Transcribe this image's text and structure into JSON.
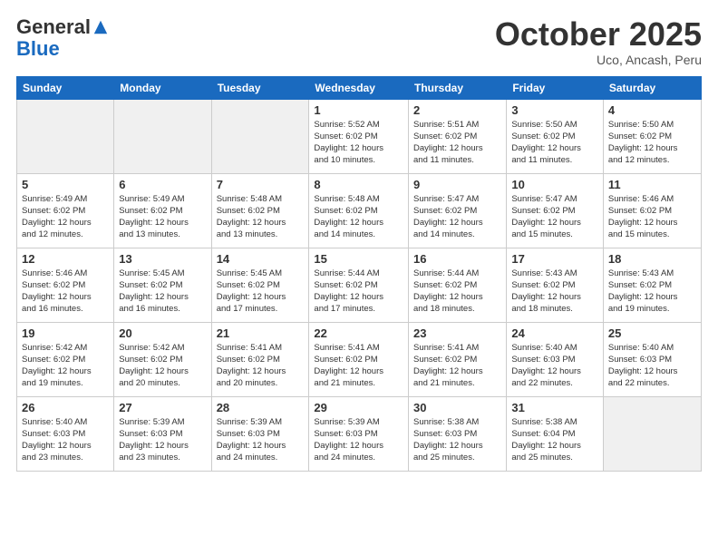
{
  "header": {
    "logo_general": "General",
    "logo_blue": "Blue",
    "month_title": "October 2025",
    "location": "Uco, Ancash, Peru"
  },
  "weekdays": [
    "Sunday",
    "Monday",
    "Tuesday",
    "Wednesday",
    "Thursday",
    "Friday",
    "Saturday"
  ],
  "weeks": [
    [
      {
        "day": "",
        "info": "",
        "empty": true
      },
      {
        "day": "",
        "info": "",
        "empty": true
      },
      {
        "day": "",
        "info": "",
        "empty": true
      },
      {
        "day": "1",
        "info": "Sunrise: 5:52 AM\nSunset: 6:02 PM\nDaylight: 12 hours\nand 10 minutes.",
        "empty": false
      },
      {
        "day": "2",
        "info": "Sunrise: 5:51 AM\nSunset: 6:02 PM\nDaylight: 12 hours\nand 11 minutes.",
        "empty": false
      },
      {
        "day": "3",
        "info": "Sunrise: 5:50 AM\nSunset: 6:02 PM\nDaylight: 12 hours\nand 11 minutes.",
        "empty": false
      },
      {
        "day": "4",
        "info": "Sunrise: 5:50 AM\nSunset: 6:02 PM\nDaylight: 12 hours\nand 12 minutes.",
        "empty": false
      }
    ],
    [
      {
        "day": "5",
        "info": "Sunrise: 5:49 AM\nSunset: 6:02 PM\nDaylight: 12 hours\nand 12 minutes.",
        "empty": false
      },
      {
        "day": "6",
        "info": "Sunrise: 5:49 AM\nSunset: 6:02 PM\nDaylight: 12 hours\nand 13 minutes.",
        "empty": false
      },
      {
        "day": "7",
        "info": "Sunrise: 5:48 AM\nSunset: 6:02 PM\nDaylight: 12 hours\nand 13 minutes.",
        "empty": false
      },
      {
        "day": "8",
        "info": "Sunrise: 5:48 AM\nSunset: 6:02 PM\nDaylight: 12 hours\nand 14 minutes.",
        "empty": false
      },
      {
        "day": "9",
        "info": "Sunrise: 5:47 AM\nSunset: 6:02 PM\nDaylight: 12 hours\nand 14 minutes.",
        "empty": false
      },
      {
        "day": "10",
        "info": "Sunrise: 5:47 AM\nSunset: 6:02 PM\nDaylight: 12 hours\nand 15 minutes.",
        "empty": false
      },
      {
        "day": "11",
        "info": "Sunrise: 5:46 AM\nSunset: 6:02 PM\nDaylight: 12 hours\nand 15 minutes.",
        "empty": false
      }
    ],
    [
      {
        "day": "12",
        "info": "Sunrise: 5:46 AM\nSunset: 6:02 PM\nDaylight: 12 hours\nand 16 minutes.",
        "empty": false
      },
      {
        "day": "13",
        "info": "Sunrise: 5:45 AM\nSunset: 6:02 PM\nDaylight: 12 hours\nand 16 minutes.",
        "empty": false
      },
      {
        "day": "14",
        "info": "Sunrise: 5:45 AM\nSunset: 6:02 PM\nDaylight: 12 hours\nand 17 minutes.",
        "empty": false
      },
      {
        "day": "15",
        "info": "Sunrise: 5:44 AM\nSunset: 6:02 PM\nDaylight: 12 hours\nand 17 minutes.",
        "empty": false
      },
      {
        "day": "16",
        "info": "Sunrise: 5:44 AM\nSunset: 6:02 PM\nDaylight: 12 hours\nand 18 minutes.",
        "empty": false
      },
      {
        "day": "17",
        "info": "Sunrise: 5:43 AM\nSunset: 6:02 PM\nDaylight: 12 hours\nand 18 minutes.",
        "empty": false
      },
      {
        "day": "18",
        "info": "Sunrise: 5:43 AM\nSunset: 6:02 PM\nDaylight: 12 hours\nand 19 minutes.",
        "empty": false
      }
    ],
    [
      {
        "day": "19",
        "info": "Sunrise: 5:42 AM\nSunset: 6:02 PM\nDaylight: 12 hours\nand 19 minutes.",
        "empty": false
      },
      {
        "day": "20",
        "info": "Sunrise: 5:42 AM\nSunset: 6:02 PM\nDaylight: 12 hours\nand 20 minutes.",
        "empty": false
      },
      {
        "day": "21",
        "info": "Sunrise: 5:41 AM\nSunset: 6:02 PM\nDaylight: 12 hours\nand 20 minutes.",
        "empty": false
      },
      {
        "day": "22",
        "info": "Sunrise: 5:41 AM\nSunset: 6:02 PM\nDaylight: 12 hours\nand 21 minutes.",
        "empty": false
      },
      {
        "day": "23",
        "info": "Sunrise: 5:41 AM\nSunset: 6:02 PM\nDaylight: 12 hours\nand 21 minutes.",
        "empty": false
      },
      {
        "day": "24",
        "info": "Sunrise: 5:40 AM\nSunset: 6:03 PM\nDaylight: 12 hours\nand 22 minutes.",
        "empty": false
      },
      {
        "day": "25",
        "info": "Sunrise: 5:40 AM\nSunset: 6:03 PM\nDaylight: 12 hours\nand 22 minutes.",
        "empty": false
      }
    ],
    [
      {
        "day": "26",
        "info": "Sunrise: 5:40 AM\nSunset: 6:03 PM\nDaylight: 12 hours\nand 23 minutes.",
        "empty": false
      },
      {
        "day": "27",
        "info": "Sunrise: 5:39 AM\nSunset: 6:03 PM\nDaylight: 12 hours\nand 23 minutes.",
        "empty": false
      },
      {
        "day": "28",
        "info": "Sunrise: 5:39 AM\nSunset: 6:03 PM\nDaylight: 12 hours\nand 24 minutes.",
        "empty": false
      },
      {
        "day": "29",
        "info": "Sunrise: 5:39 AM\nSunset: 6:03 PM\nDaylight: 12 hours\nand 24 minutes.",
        "empty": false
      },
      {
        "day": "30",
        "info": "Sunrise: 5:38 AM\nSunset: 6:03 PM\nDaylight: 12 hours\nand 25 minutes.",
        "empty": false
      },
      {
        "day": "31",
        "info": "Sunrise: 5:38 AM\nSunset: 6:04 PM\nDaylight: 12 hours\nand 25 minutes.",
        "empty": false
      },
      {
        "day": "",
        "info": "",
        "empty": true
      }
    ]
  ]
}
